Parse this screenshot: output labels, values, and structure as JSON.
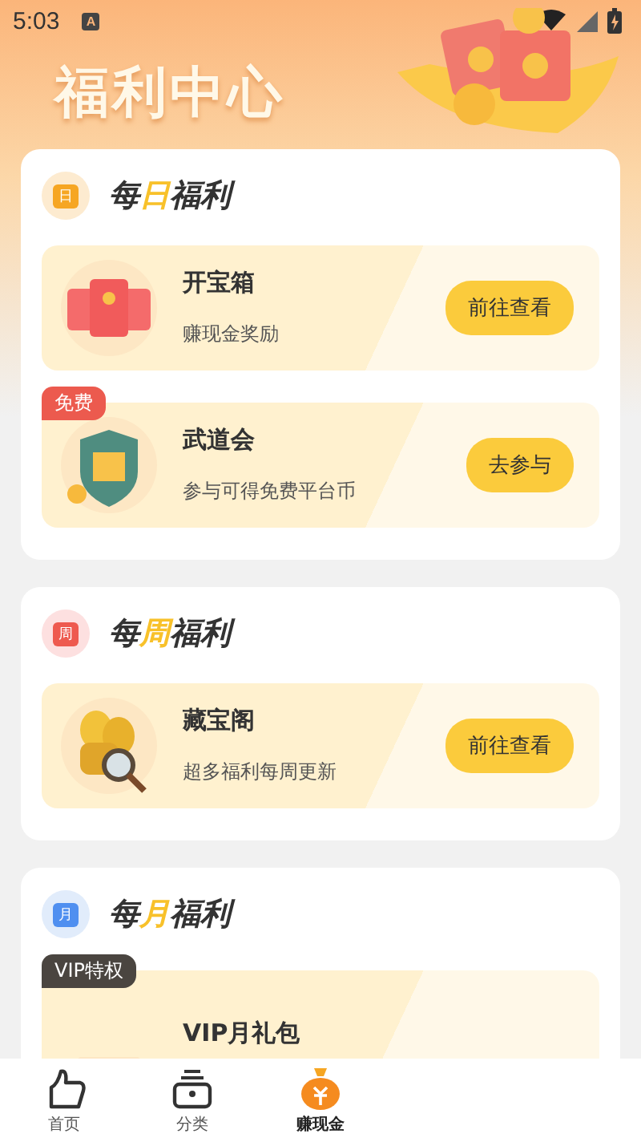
{
  "status_bar": {
    "time": "5:03",
    "notification": "A"
  },
  "header": {
    "title": "福利中心"
  },
  "sections": [
    {
      "kind": "day",
      "icon_text": "日",
      "heading": {
        "prefix": "每",
        "accent": "日",
        "suffix": "福利"
      },
      "items": [
        {
          "kind": "envelopes",
          "title": "开宝箱",
          "subtitle": "赚现金奖励",
          "button": "前往查看"
        },
        {
          "kind": "shield",
          "title": "武道会",
          "subtitle": "参与可得免费平台币",
          "button": "去参与",
          "badge": {
            "kind": "free",
            "text": "免费"
          }
        }
      ]
    },
    {
      "kind": "week",
      "icon_text": "周",
      "heading": {
        "prefix": "每",
        "accent": "周",
        "suffix": "福利"
      },
      "items": [
        {
          "kind": "coins",
          "title": "藏宝阁",
          "subtitle": "超多福利每周更新",
          "button": "前往查看"
        }
      ]
    },
    {
      "kind": "month",
      "icon_text": "月",
      "heading": {
        "prefix": "每",
        "accent": "月",
        "suffix": "福利"
      },
      "items": [
        {
          "kind": "gift",
          "title": "VIP月礼包",
          "badge": {
            "kind": "vip",
            "text": "VIP特权"
          }
        }
      ]
    }
  ],
  "nav": [
    {
      "kind": "home",
      "label": "首页",
      "selected": false
    },
    {
      "kind": "category",
      "label": "分类",
      "selected": false
    },
    {
      "kind": "earn",
      "label": "赚现金",
      "selected": true
    }
  ]
}
